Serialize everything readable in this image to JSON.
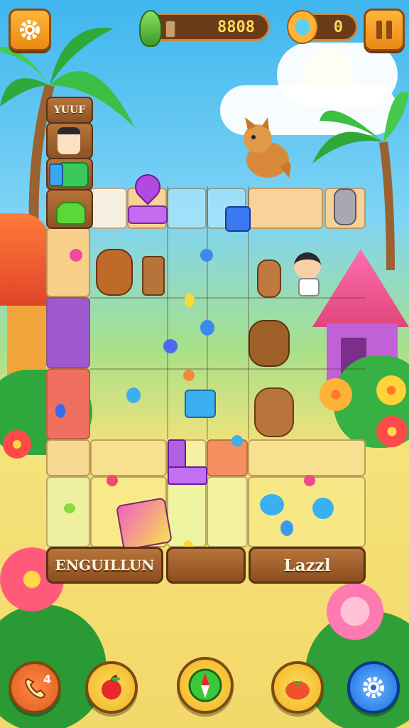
{
  "hud": {
    "coins": "8808",
    "gems": "0",
    "settings_icon": "gear-icon",
    "pause_icon": "pause-icon"
  },
  "side_panel": {
    "header_label": "YUUF",
    "slots": [
      "child-portrait",
      "green-block-piece",
      "green-slime-piece"
    ]
  },
  "bottom_labels": {
    "left": "ENGUILLUN",
    "right": "Lazzl"
  },
  "bottom_bar": [
    {
      "name": "phone-booster-button",
      "icon": "phone-icon",
      "badge": "4"
    },
    {
      "name": "apple-booster-button",
      "icon": "apple-icon"
    },
    {
      "name": "compass-booster-button",
      "icon": "compass-icon"
    },
    {
      "name": "tomato-booster-button",
      "icon": "tomato-icon"
    },
    {
      "name": "settings-round-button",
      "icon": "gear-icon"
    }
  ],
  "colors": {
    "sky": "#3fb6ee",
    "hud_orange": "#ffb43a",
    "wood": "#8a4e20",
    "counter_text": "#ffd85a"
  }
}
